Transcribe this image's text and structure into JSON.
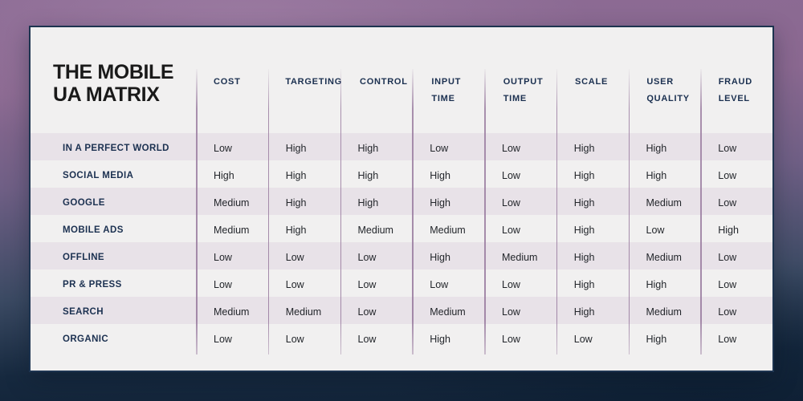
{
  "page": {
    "title": "THE MOBILE UA MATRIX",
    "title_line1": "THE MOBILE",
    "title_line2": "UA MATRIX",
    "background_top_color": "#8c6b94",
    "background_bottom_color": "#122338",
    "card_background": "#f1f0f0",
    "card_border_color": "#1d3450",
    "header_text_color": "#1b3050",
    "divider_color": "#9b7ea1",
    "stripe_color": "#e8e2e8",
    "cell_text_color": "#23262b"
  },
  "table": {
    "row_label_header": "",
    "columns": [
      "COST",
      "TARGETING",
      "CONTROL",
      "INPUT TIME",
      "OUTPUT TIME",
      "SCALE",
      "USER QUALITY",
      "FRAUD LEVEL"
    ],
    "columns_wrapped": [
      [
        "COST"
      ],
      [
        "TARGETING"
      ],
      [
        "CONTROL"
      ],
      [
        "INPUT",
        "TIME"
      ],
      [
        "OUTPUT",
        "TIME"
      ],
      [
        "SCALE"
      ],
      [
        "USER",
        "QUALITY"
      ],
      [
        "FRAUD",
        "LEVEL"
      ]
    ],
    "rows": [
      {
        "label": "IN A PERFECT WORLD",
        "values": [
          "Low",
          "High",
          "High",
          "Low",
          "Low",
          "High",
          "High",
          "Low"
        ]
      },
      {
        "label": "SOCIAL MEDIA",
        "values": [
          "High",
          "High",
          "High",
          "High",
          "Low",
          "High",
          "High",
          "Low"
        ]
      },
      {
        "label": "GOOGLE",
        "values": [
          "Medium",
          "High",
          "High",
          "High",
          "Low",
          "High",
          "Medium",
          "Low"
        ]
      },
      {
        "label": "MOBILE ADS",
        "values": [
          "Medium",
          "High",
          "Medium",
          "Medium",
          "Low",
          "High",
          "Low",
          "High"
        ]
      },
      {
        "label": "OFFLINE",
        "values": [
          "Low",
          "Low",
          "Low",
          "High",
          "Medium",
          "High",
          "Medium",
          "Low"
        ]
      },
      {
        "label": "PR & PRESS",
        "values": [
          "Low",
          "Low",
          "Low",
          "Low",
          "Low",
          "High",
          "High",
          "Low"
        ]
      },
      {
        "label": "SEARCH",
        "values": [
          "Medium",
          "Medium",
          "Low",
          "Medium",
          "Low",
          "High",
          "Medium",
          "Low"
        ]
      },
      {
        "label": "ORGANIC",
        "values": [
          "Low",
          "Low",
          "Low",
          "High",
          "Low",
          "Low",
          "High",
          "Low"
        ]
      }
    ]
  }
}
